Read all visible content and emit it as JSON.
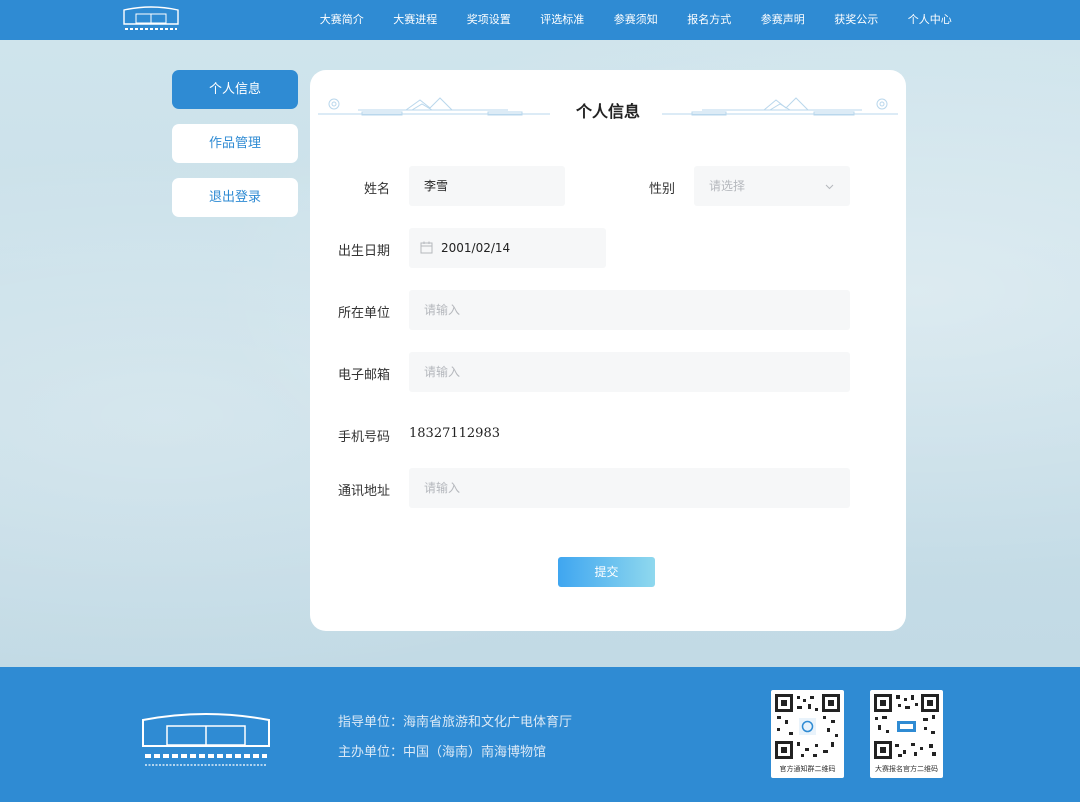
{
  "header": {
    "nav": [
      "大赛简介",
      "大赛进程",
      "奖项设置",
      "评选标准",
      "参赛须知",
      "报名方式",
      "参赛声明",
      "获奖公示",
      "个人中心"
    ]
  },
  "sidebar": {
    "items": [
      {
        "label": "个人信息",
        "active": true
      },
      {
        "label": "作品管理",
        "active": false
      },
      {
        "label": "退出登录",
        "active": false
      }
    ]
  },
  "profile": {
    "title": "个人信息",
    "name": {
      "label": "姓名",
      "value": "李雪"
    },
    "gender": {
      "label": "性别",
      "placeholder": "请选择"
    },
    "birthday": {
      "label": "出生日期",
      "value": "2001/02/14"
    },
    "organization": {
      "label": "所在单位",
      "placeholder": "请输入"
    },
    "email": {
      "label": "电子邮箱",
      "placeholder": "请输入"
    },
    "phone": {
      "label": "手机号码",
      "value": "18327112983"
    },
    "address": {
      "label": "通讯地址",
      "placeholder": "请输入"
    },
    "submit_label": "提交"
  },
  "footer": {
    "guide_unit": "指导单位：海南省旅游和文化广电体育厅",
    "host_unit": "主办单位：中国（海南）南海博物馆",
    "qr_captions": [
      "官方通知群二维码",
      "大赛报名官方二维码"
    ]
  },
  "colors": {
    "primary": "#2f8bd3",
    "page_bg": "#c6dde7"
  },
  "icons": [
    "museum-logo-icon",
    "calendar-icon",
    "chevron-down-icon",
    "qr-code-icon"
  ]
}
